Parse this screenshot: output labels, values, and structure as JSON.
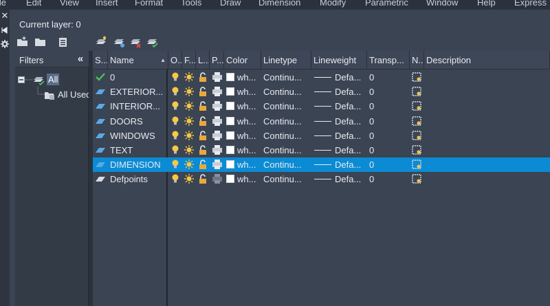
{
  "menubar": {
    "items": [
      "ile",
      "Edit",
      "View",
      "Insert",
      "Format",
      "Tools",
      "Draw",
      "Dimension",
      "Modify",
      "Parametric",
      "Window",
      "Help",
      "Express"
    ]
  },
  "left_strip": {
    "icons": [
      "close-icon",
      "autohide-icon",
      "properties-icon"
    ]
  },
  "header": {
    "current_layer": "Current layer: 0"
  },
  "toolbar": {
    "buttons": [
      "new-property-filter-icon",
      "new-group-filter-icon",
      "layer-states-manager-icon",
      "new-layer-icon",
      "new-layer-vp-frozen-icon",
      "delete-layer-icon",
      "set-current-icon"
    ]
  },
  "filters": {
    "title": "Filters",
    "collapse": "«",
    "tree": [
      {
        "label": "All",
        "selected": true
      },
      {
        "label": "All Used Layers"
      }
    ]
  },
  "grid": {
    "columns": [
      "S...",
      "Name",
      "O...",
      "F...",
      "L...",
      "P...",
      "Color",
      "Linetype",
      "Lineweight",
      "Transp...",
      "N...",
      "Description"
    ],
    "sort_indicator": "▲",
    "rows": [
      {
        "status": "current",
        "name": "0",
        "color": "wh...",
        "linetype": "Continu...",
        "lineweight": "Defa...",
        "transparency": "0",
        "selected": false
      },
      {
        "status": "layer",
        "name": "EXTERIOR...",
        "color": "wh...",
        "linetype": "Continu...",
        "lineweight": "Defa...",
        "transparency": "0",
        "selected": false
      },
      {
        "status": "layer",
        "name": "INTERIOR...",
        "color": "wh...",
        "linetype": "Continu...",
        "lineweight": "Defa...",
        "transparency": "0",
        "selected": false
      },
      {
        "status": "layer",
        "name": "DOORS",
        "color": "wh...",
        "linetype": "Continu...",
        "lineweight": "Defa...",
        "transparency": "0",
        "selected": false
      },
      {
        "status": "layer",
        "name": "WINDOWS",
        "color": "wh...",
        "linetype": "Continu...",
        "lineweight": "Defa...",
        "transparency": "0",
        "selected": false
      },
      {
        "status": "layer",
        "name": "TEXT",
        "color": "wh...",
        "linetype": "Continu...",
        "lineweight": "Defa...",
        "transparency": "0",
        "selected": false
      },
      {
        "status": "layer",
        "name": "DIMENSION",
        "color": "wh...",
        "linetype": "Continu...",
        "lineweight": "Defa...",
        "transparency": "0",
        "selected": true
      },
      {
        "status": "layer-unused",
        "name": "Defpoints",
        "color": "wh...",
        "linetype": "Continu...",
        "lineweight": "Defa...",
        "transparency": "0",
        "selected": false,
        "plot": "no-plot"
      }
    ]
  },
  "colors": {
    "background": "#3b4453",
    "selection": "#0b8bd4",
    "bulb": "#f6c945",
    "sun": "#f3c64a",
    "lock": "#e8a93c",
    "layer_icon": "#5aa9e6",
    "check": "#4cc05a"
  }
}
